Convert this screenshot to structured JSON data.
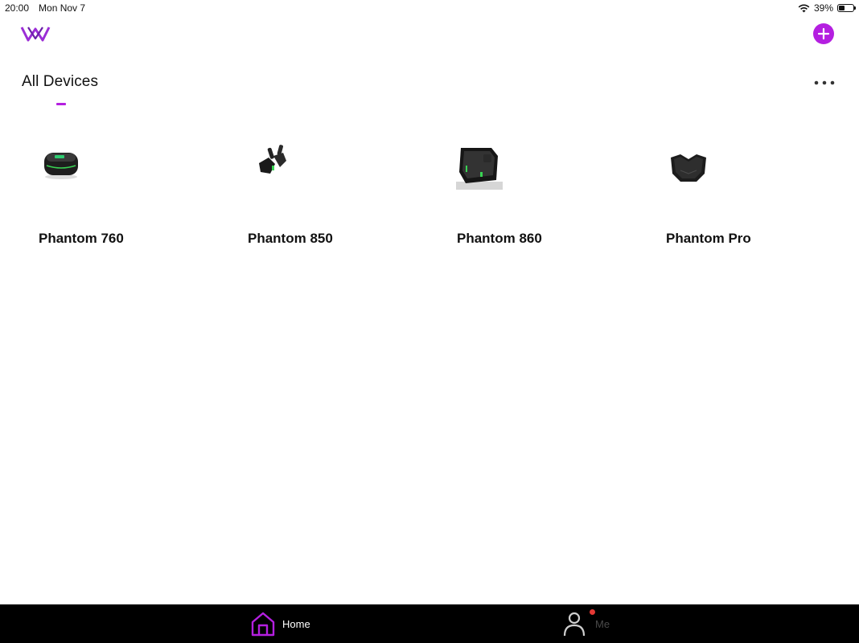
{
  "status_bar": {
    "time": "20:00",
    "date": "Mon Nov 7",
    "battery_percent": "39%",
    "battery_level": 0.39
  },
  "header": {
    "logo_icon": "brand-w-logo-icon",
    "add_icon": "plus-circle-icon",
    "accent_color": "#b41fe0"
  },
  "page": {
    "title": "All Devices",
    "more_icon": "more-horizontal-icon"
  },
  "devices": [
    {
      "name": "Phantom 760",
      "icon": "earbuds-case-icon"
    },
    {
      "name": "Phantom 850",
      "icon": "earbuds-icon"
    },
    {
      "name": "Phantom 860",
      "icon": "earbuds-case-square-icon"
    },
    {
      "name": "Phantom Pro",
      "icon": "earbuds-case-hex-icon"
    }
  ],
  "tab_bar": {
    "tabs": [
      {
        "label": "Home",
        "icon": "home-icon",
        "active": true
      },
      {
        "label": "Me",
        "icon": "person-icon",
        "active": false,
        "badge": true
      }
    ]
  }
}
